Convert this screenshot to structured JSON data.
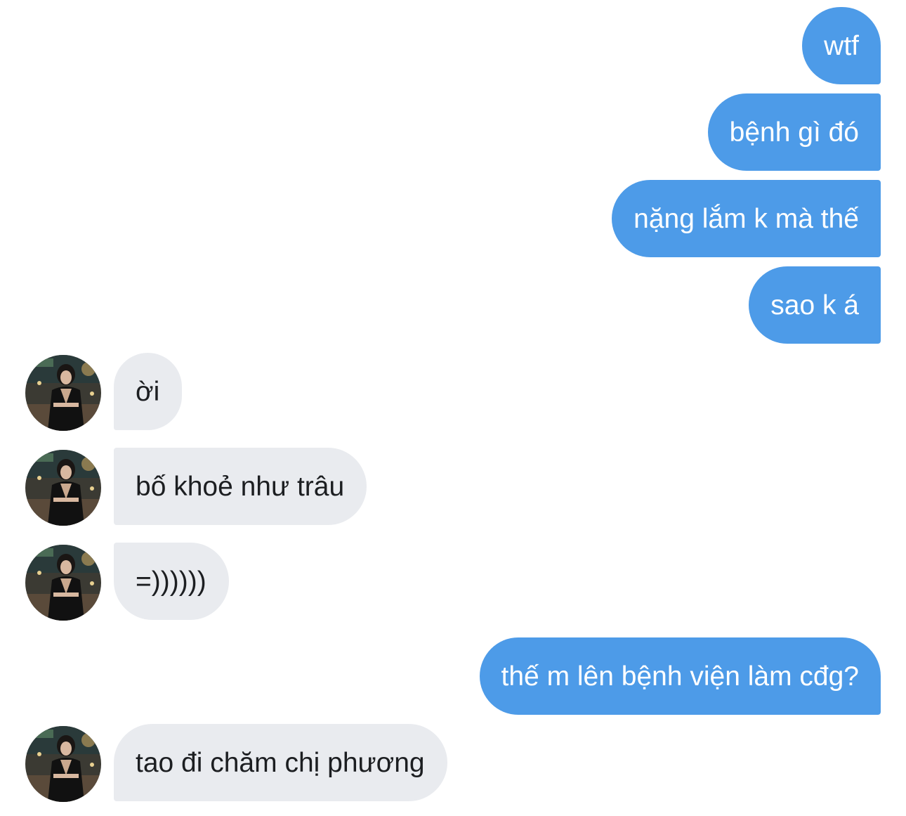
{
  "conversation": {
    "messages": [
      {
        "side": "sent",
        "text": "wtf"
      },
      {
        "side": "sent",
        "text": "bệnh gì đó"
      },
      {
        "side": "sent",
        "text": "nặng lắm k mà thế"
      },
      {
        "side": "sent",
        "text": "sao k á"
      },
      {
        "side": "received",
        "text": "ời"
      },
      {
        "side": "received",
        "text": "bố khoẻ như trâu"
      },
      {
        "side": "received",
        "text": "=))))))"
      },
      {
        "side": "sent",
        "text": "thế m lên bệnh viện làm cđg?"
      },
      {
        "side": "received",
        "text": "tao đi chăm chị phương"
      }
    ],
    "colors": {
      "sent_bubble": "#4d9be8",
      "sent_text": "#ffffff",
      "received_bubble": "#e9ebef",
      "received_text": "#1c1e21",
      "background": "#ffffff"
    },
    "contact_avatar": "contact-photo-avatar"
  }
}
